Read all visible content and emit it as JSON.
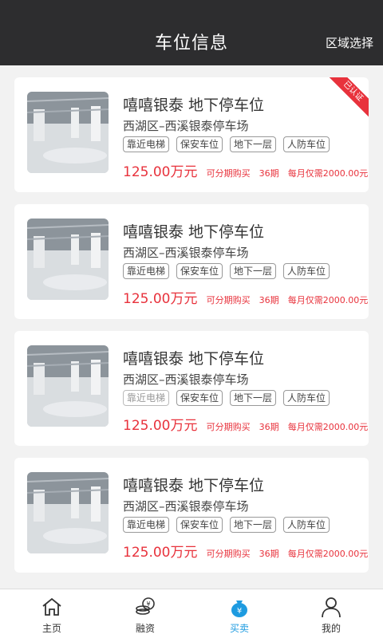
{
  "header": {
    "title": "车位信息",
    "region_label": "区域选择"
  },
  "cards": [
    {
      "name": "嘻嘻银泰 地下停车位",
      "address": "西湖区–西溪银泰停车场",
      "tags": [
        "靠近电梯",
        "保安车位",
        "地下一层",
        "人防车位"
      ],
      "price": "125.00万元",
      "installment": "可分期购买",
      "periods": "36期",
      "monthly": "每月仅需2000.00元",
      "badge": "已认证"
    },
    {
      "name": "嘻嘻银泰 地下停车位",
      "address": "西湖区–西溪银泰停车场",
      "tags": [
        "靠近电梯",
        "保安车位",
        "地下一层",
        "人防车位"
      ],
      "price": "125.00万元",
      "installment": "可分期购买",
      "periods": "36期",
      "monthly": "每月仅需2000.00元"
    },
    {
      "name": "嘻嘻银泰 地下停车位",
      "address": "西湖区–西溪银泰停车场",
      "tags": [
        "靠近电梯",
        "保安车位",
        "地下一层",
        "人防车位"
      ],
      "price": "125.00万元",
      "installment": "可分期购买",
      "periods": "36期",
      "monthly": "每月仅需2000.00元"
    },
    {
      "name": "嘻嘻银泰 地下停车位",
      "address": "西湖区–西溪银泰停车场",
      "tags": [
        "靠近电梯",
        "保安车位",
        "地下一层",
        "人防车位"
      ],
      "price": "125.00万元",
      "installment": "可分期购买",
      "periods": "36期",
      "monthly": "每月仅需2000.00元"
    }
  ],
  "tabbar": {
    "items": [
      {
        "label": "主页",
        "icon": "home-icon"
      },
      {
        "label": "融资",
        "icon": "coins-icon"
      },
      {
        "label": "买卖",
        "icon": "money-bag-icon",
        "active": true
      },
      {
        "label": "我的",
        "icon": "user-icon"
      }
    ]
  },
  "colors": {
    "accent_red": "#e8323c",
    "accent_blue": "#1e9be0",
    "header_bg": "#2d2d2f"
  }
}
